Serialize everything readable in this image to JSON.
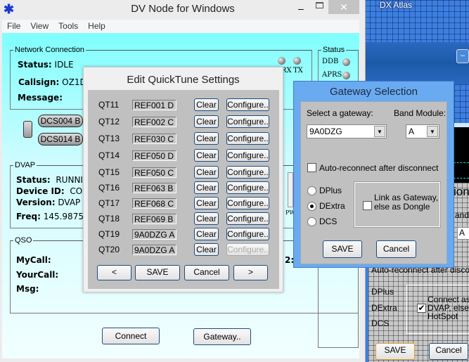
{
  "background_window": {
    "title": "DX Atlas",
    "minimize_label": "–",
    "partial_texts": {
      "title_fragment": "ion",
      "band_fragment": "and M",
      "band_value": "A",
      "auto_reconnect": "Auto-reconnect after disconne",
      "dplus": "DPlus",
      "dextra": "DExtra",
      "dcs": "DCS",
      "connect_as": "Connect as DVAP, else a HotSpot",
      "save": "SAVE",
      "cancel": "Cancel"
    },
    "connect_as_checked": true
  },
  "main": {
    "title": "DV Node for Windows",
    "menu": [
      "File",
      "View",
      "Tools",
      "Help"
    ],
    "network": {
      "legend": "Network Connection",
      "status_label": "Status:",
      "status_value": "IDLE",
      "callsign_label": "Callsign:",
      "callsign_value": "OZ1DG",
      "message_label": "Message:",
      "links": [
        "DCS004 B",
        "DCS014 B"
      ],
      "rx_label": "RX",
      "tx_label": "TX"
    },
    "status": {
      "legend": "Status",
      "ddb": "DDB",
      "aprs": "APRS"
    },
    "dvap": {
      "legend": "DVAP",
      "status_label": "Status:",
      "status_value": "RUNNIN",
      "device_label": "Device ID:",
      "device_value": "COM",
      "version_label": "Version:",
      "version_value": "DVAP D",
      "freq_label": "Freq:",
      "freq_value": "145.9875 M",
      "pwr_label": "PW"
    },
    "qso": {
      "legend": "QSO",
      "mycall": "MyCall:",
      "yourcall": "YourCall:",
      "msg": "Msg:",
      "partial": "2:"
    },
    "connect_button": "Connect",
    "gateway_button": "Gateway.."
  },
  "quicktune": {
    "title": "Edit QuickTune Settings",
    "rows": [
      {
        "label": "QT11",
        "value": "REF001 D",
        "configure_enabled": true
      },
      {
        "label": "QT12",
        "value": "REF002 C",
        "configure_enabled": true
      },
      {
        "label": "QT13",
        "value": "REF030 C",
        "configure_enabled": true
      },
      {
        "label": "QT14",
        "value": "REF050 D",
        "configure_enabled": true
      },
      {
        "label": "QT15",
        "value": "REF050 C",
        "configure_enabled": true
      },
      {
        "label": "QT16",
        "value": "REF063 B",
        "configure_enabled": true
      },
      {
        "label": "QT17",
        "value": "REF068 C",
        "configure_enabled": true
      },
      {
        "label": "QT18",
        "value": "REF069 B",
        "configure_enabled": true
      },
      {
        "label": "QT19",
        "value": "9A0DZG A",
        "configure_enabled": true
      },
      {
        "label": "QT20",
        "value": "9A0DZG A",
        "configure_enabled": false
      }
    ],
    "clear_label": "Clear",
    "configure_label": "Configure..",
    "prev_label": "<",
    "save_label": "SAVE",
    "cancel_label": "Cancel",
    "next_label": ">"
  },
  "gateway": {
    "title": "Gateway Selection",
    "select_label": "Select a gateway:",
    "gateway_value": "9A0DZG",
    "band_label": "Band Module:",
    "band_value": "A",
    "auto_reconnect_label": "Auto-reconnect after disconnect",
    "auto_reconnect_checked": false,
    "protocols": [
      "DPlus",
      "DExtra",
      "DCS"
    ],
    "selected_protocol": "DExtra",
    "link_as_gateway_label": "Link as Gateway, else as Dongle",
    "link_as_gateway_checked": false,
    "save_label": "SAVE",
    "cancel_label": "Cancel"
  }
}
